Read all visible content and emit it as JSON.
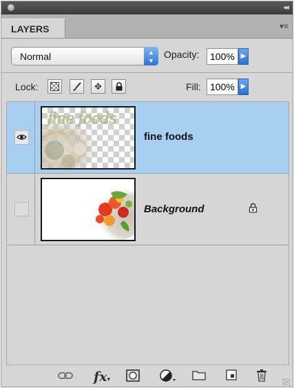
{
  "panel": {
    "tab_label": "LAYERS",
    "collapse_glyph": "◂◂",
    "menu_glyph": "▾≡"
  },
  "blend": {
    "mode": "Normal",
    "opacity_label": "Opacity:",
    "opacity_value": "100%"
  },
  "lock": {
    "label": "Lock:",
    "fill_label": "Fill:",
    "fill_value": "100%"
  },
  "layers": [
    {
      "name": "fine foods",
      "visible": true,
      "selected": true,
      "locked": false,
      "thumb_text": "fine foods"
    },
    {
      "name": "Background",
      "visible": false,
      "selected": false,
      "locked": true
    }
  ],
  "colors": {
    "selection": "#a7cff1",
    "accent_blue": "#2c6fcd",
    "panel_bg": "#d6d6d6"
  },
  "bottom_icons": [
    "link-icon",
    "fx-icon",
    "mask-icon",
    "adjustment-icon",
    "folder-icon",
    "new-layer-icon",
    "trash-icon"
  ]
}
